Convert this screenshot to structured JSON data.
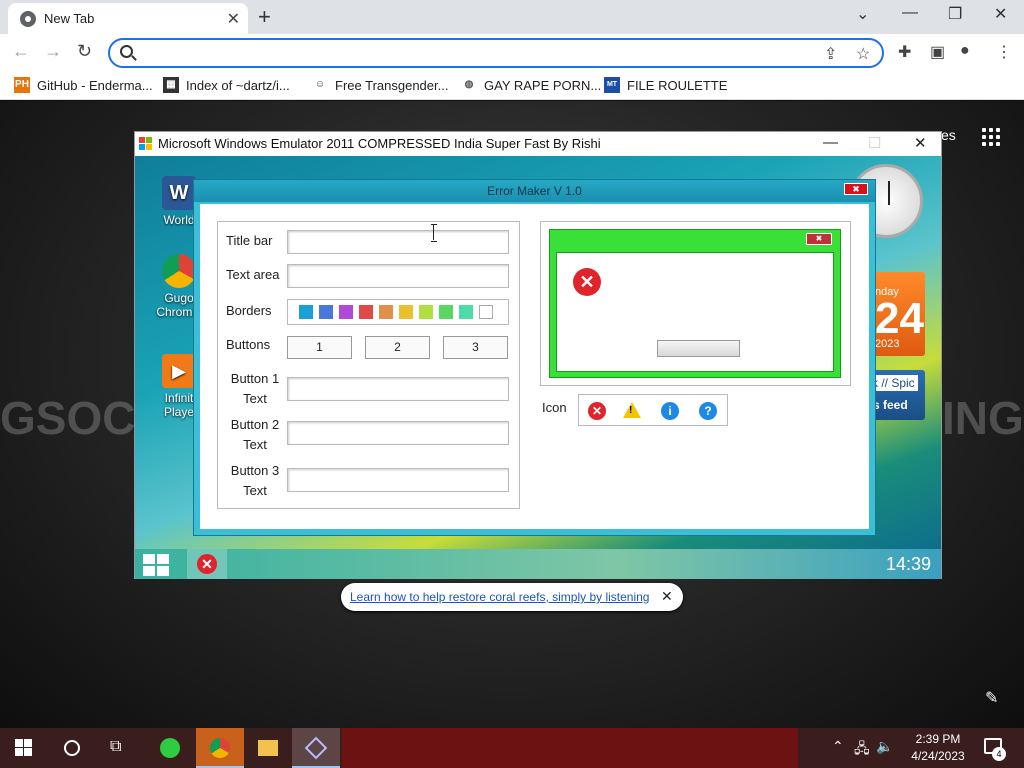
{
  "browser": {
    "tab_title": "New Tab",
    "url": "",
    "bookmarks": [
      {
        "label": "GitHub - Enderma..."
      },
      {
        "label": "Index of ~dartz/i..."
      },
      {
        "label": "Free Transgender..."
      },
      {
        "label": "GAY RAPE PORN..."
      },
      {
        "label": "FILE ROULETTE"
      }
    ]
  },
  "page": {
    "background_words": [
      "GSOC",
      "ING"
    ],
    "partial_text": "es"
  },
  "emulator": {
    "title": "Microsoft Windows Emulator 2011 COMPRESSED India Super Fast By Rishi",
    "desktop_icons": [
      {
        "label": "World"
      },
      {
        "label": "Gugo Chromiu"
      },
      {
        "label": "Infinit Playe"
      }
    ],
    "calendar": {
      "day": "nday",
      "date": "24",
      "year": "2023"
    },
    "feed": {
      "line1": "k // Spic",
      "line2": "s feed"
    },
    "taskbar_time": "14:39"
  },
  "error_maker": {
    "title": "Error Maker V 1.0",
    "labels": {
      "title_bar": "Title bar",
      "text_area": "Text area",
      "borders": "Borders",
      "buttons": "Buttons",
      "button1": "Button 1 Text",
      "button2": "Button 2 Text",
      "button3": "Button 3 Text",
      "icon": "Icon"
    },
    "button_choices": [
      "1",
      "2",
      "3"
    ],
    "border_colors": [
      "#1a9fd6",
      "#4a78d8",
      "#b04ad8",
      "#e04a4a",
      "#e0904a",
      "#e8c030",
      "#b0e040",
      "#58d860",
      "#50dca8",
      "#ffffff"
    ],
    "icons": [
      "error",
      "warning",
      "info",
      "question"
    ]
  },
  "notification": {
    "link": "Learn how to help restore coral reefs, simply by listening"
  },
  "windows_taskbar": {
    "time": "2:39 PM",
    "date": "4/24/2023",
    "notification_count": "4"
  },
  "colors": {
    "accent": "#1a73e8",
    "error_maker_frame": "#3bbed6",
    "preview_border": "#38e038",
    "error_red": "#e0242c"
  }
}
